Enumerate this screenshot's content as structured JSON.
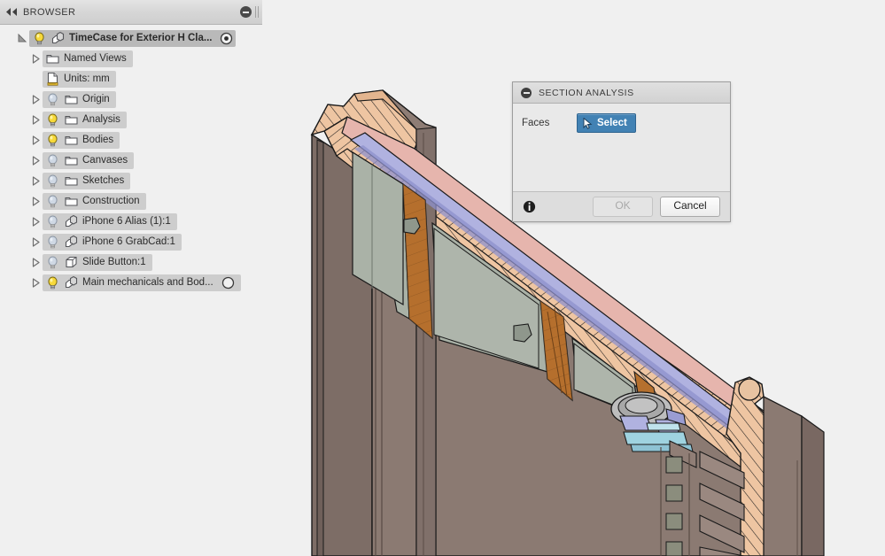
{
  "browser": {
    "header": {
      "collapse_icon": "double-chevron-left-icon",
      "title": "BROWSER",
      "minimize_icon": "circle-minus-icon",
      "grip_icon": "resize-grip-icon"
    },
    "root": {
      "twisty": "triangle-expanded-icon",
      "bulb_icon": "lightbulb-on-icon",
      "bulb_state": "on",
      "type_icon": "component-icon",
      "label": "TimeCase for Exterior H Cla...",
      "trailing_icon": "target-dot-icon"
    },
    "items": [
      {
        "twisty": "triangle-collapsed-icon",
        "has_twisty": true,
        "bulb": "none",
        "type_icon": "folder-icon",
        "label": "Named Views",
        "trailing_icon": null
      },
      {
        "twisty": "none",
        "has_twisty": false,
        "bulb": "none",
        "type_icon": "units-doc-icon",
        "label": "Units: mm",
        "trailing_icon": null
      },
      {
        "twisty": "triangle-collapsed-icon",
        "has_twisty": true,
        "bulb": "lightbulb-off-icon",
        "type_icon": "folder-icon",
        "label": "Origin",
        "trailing_icon": null
      },
      {
        "twisty": "triangle-collapsed-icon",
        "has_twisty": true,
        "bulb": "lightbulb-on-icon",
        "type_icon": "folder-icon",
        "label": "Analysis",
        "trailing_icon": null
      },
      {
        "twisty": "triangle-collapsed-icon",
        "has_twisty": true,
        "bulb": "lightbulb-on-icon",
        "type_icon": "folder-icon",
        "label": "Bodies",
        "trailing_icon": null
      },
      {
        "twisty": "triangle-collapsed-icon",
        "has_twisty": true,
        "bulb": "lightbulb-off-icon",
        "type_icon": "folder-icon",
        "label": "Canvases",
        "trailing_icon": null
      },
      {
        "twisty": "triangle-collapsed-icon",
        "has_twisty": true,
        "bulb": "lightbulb-off-icon",
        "type_icon": "folder-icon",
        "label": "Sketches",
        "trailing_icon": null
      },
      {
        "twisty": "triangle-collapsed-icon",
        "has_twisty": true,
        "bulb": "lightbulb-off-icon",
        "type_icon": "folder-icon",
        "label": "Construction",
        "trailing_icon": null
      },
      {
        "twisty": "triangle-collapsed-icon",
        "has_twisty": true,
        "bulb": "lightbulb-off-icon",
        "type_icon": "component-icon",
        "label": "iPhone 6 Alias (1):1",
        "trailing_icon": null
      },
      {
        "twisty": "triangle-collapsed-icon",
        "has_twisty": true,
        "bulb": "lightbulb-off-icon",
        "type_icon": "component-icon",
        "label": "iPhone 6 GrabCad:1",
        "trailing_icon": null
      },
      {
        "twisty": "triangle-collapsed-icon",
        "has_twisty": true,
        "bulb": "lightbulb-off-icon",
        "type_icon": "body-cube-icon",
        "label": "Slide Button:1",
        "trailing_icon": null
      },
      {
        "twisty": "triangle-collapsed-icon",
        "has_twisty": true,
        "bulb": "lightbulb-on-icon",
        "type_icon": "component-icon",
        "label": "Main mechanicals and Bod...",
        "trailing_icon": "circle-outline-icon"
      }
    ]
  },
  "dialog": {
    "minimize_icon": "circle-minus-icon",
    "title": "SECTION ANALYSIS",
    "faces_label": "Faces",
    "select_button": {
      "icon": "cursor-arrow-icon",
      "label": "Select"
    },
    "info_icon": "info-circle-icon",
    "ok_label": "OK",
    "ok_enabled": false,
    "cancel_label": "Cancel"
  },
  "viewport": {
    "name": "3d-model-canvas",
    "background": "#f0f0f0",
    "model_description": "Sectioned CAD assembly of a phone case mounted in an extruded aluminium door profile",
    "colors": {
      "body_brown": "#8b7a72",
      "body_brown_dark": "#7a6a63",
      "body_brown_light": "#9c8b83",
      "cut_hatch_tan": "#e8be99",
      "internal_gray": "#a9b1a6",
      "copper": "#b5702e",
      "lavender": "#b0b2e0",
      "pink": "#e6b5ad",
      "cyan": "#9fd3e0",
      "outline": "#1a1a1a"
    }
  }
}
